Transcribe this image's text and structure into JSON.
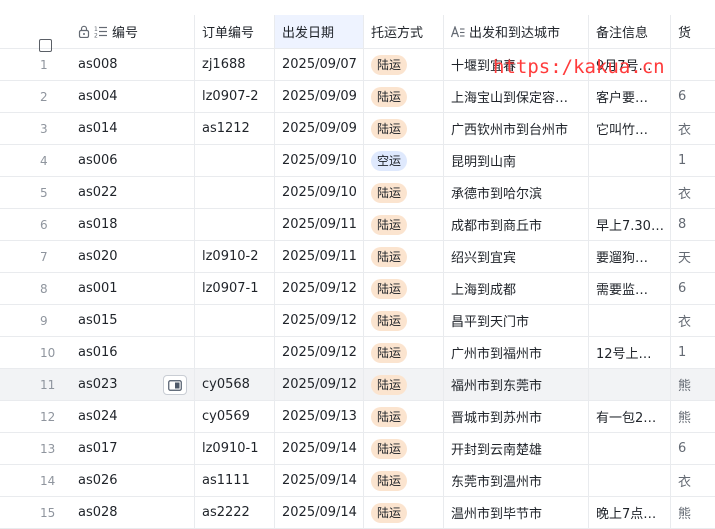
{
  "header": {
    "columns": {
      "code": "编号",
      "order": "订单编号",
      "date": "出发日期",
      "mode": "托运方式",
      "route": "出发和到达城市",
      "note": "备注信息",
      "extra": "货"
    }
  },
  "colors": {
    "tag_land_bg": "#fbe4cf",
    "tag_air_bg": "#dfe9fd",
    "watermark": "#ff3b3b"
  },
  "rows": [
    {
      "idx": "1",
      "code": "as008",
      "order": "zj1688",
      "date": "2025/09/07",
      "mode": "陆运",
      "route": "十堰到宜春",
      "note": "9月7号…",
      "extra": ""
    },
    {
      "idx": "2",
      "code": "as004",
      "order": "lz0907-2",
      "date": "2025/09/09",
      "mode": "陆运",
      "route": "上海宝山到保定容…",
      "note": "客户要…",
      "extra": "6"
    },
    {
      "idx": "3",
      "code": "as014",
      "order": "as1212",
      "date": "2025/09/09",
      "mode": "陆运",
      "route": "广西钦州市到台州市",
      "note": "它叫竹…",
      "extra": "衣"
    },
    {
      "idx": "4",
      "code": "as006",
      "order": "",
      "date": "2025/09/10",
      "mode": "空运",
      "route": "昆明到山南",
      "note": "",
      "extra": "1"
    },
    {
      "idx": "5",
      "code": "as022",
      "order": "",
      "date": "2025/09/10",
      "mode": "陆运",
      "route": "承德市到哈尔滨",
      "note": "",
      "extra": "衣"
    },
    {
      "idx": "6",
      "code": "as018",
      "order": "",
      "date": "2025/09/11",
      "mode": "陆运",
      "route": "成都市到商丘市",
      "note": "早上7.30…",
      "extra": "8"
    },
    {
      "idx": "7",
      "code": "as020",
      "order": "lz0910-2",
      "date": "2025/09/11",
      "mode": "陆运",
      "route": "绍兴到宜宾",
      "note": "要遛狗…",
      "extra": "天"
    },
    {
      "idx": "8",
      "code": "as001",
      "order": "lz0907-1",
      "date": "2025/09/12",
      "mode": "陆运",
      "route": "上海到成都",
      "note": "需要监…",
      "extra": "6"
    },
    {
      "idx": "9",
      "code": "as015",
      "order": "",
      "date": "2025/09/12",
      "mode": "陆运",
      "route": "昌平到天门市",
      "note": "",
      "extra": "衣"
    },
    {
      "idx": "10",
      "code": "as016",
      "order": "",
      "date": "2025/09/12",
      "mode": "陆运",
      "route": "广州市到福州市",
      "note": "12号上…",
      "extra": "1"
    },
    {
      "idx": "11",
      "code": "as023",
      "order": "cy0568",
      "date": "2025/09/12",
      "mode": "陆运",
      "route": "福州市到东莞市",
      "note": "",
      "extra": "熊"
    },
    {
      "idx": "12",
      "code": "as024",
      "order": "cy0569",
      "date": "2025/09/13",
      "mode": "陆运",
      "route": "晋城市到苏州市",
      "note": "有一包2…",
      "extra": "熊"
    },
    {
      "idx": "13",
      "code": "as017",
      "order": "lz0910-1",
      "date": "2025/09/14",
      "mode": "陆运",
      "route": "开封到云南楚雄",
      "note": "",
      "extra": "6"
    },
    {
      "idx": "14",
      "code": "as026",
      "order": "as1111",
      "date": "2025/09/14",
      "mode": "陆运",
      "route": "东莞市到温州市",
      "note": "",
      "extra": "衣"
    },
    {
      "idx": "15",
      "code": "as028",
      "order": "as2222",
      "date": "2025/09/14",
      "mode": "陆运",
      "route": "温州市到毕节市",
      "note": "晚上7点…",
      "extra": "熊"
    }
  ],
  "watermark": "https:/kakua.cn"
}
